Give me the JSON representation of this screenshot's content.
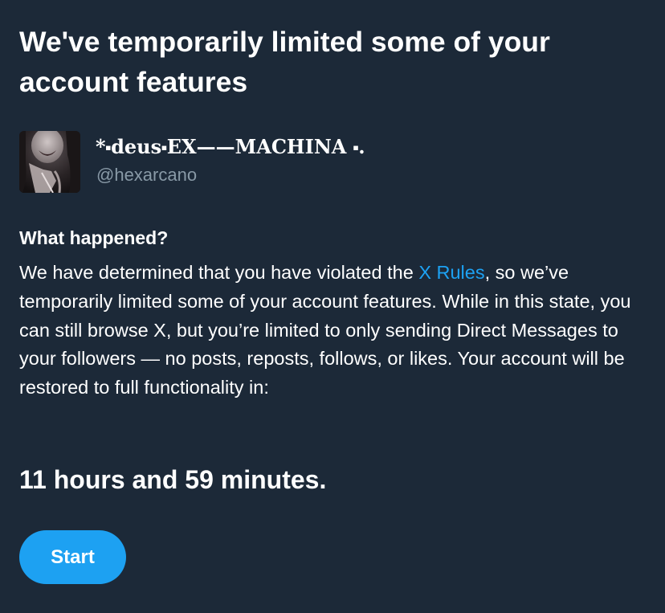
{
  "header": {
    "title": "We've temporarily limited some of your account features"
  },
  "account": {
    "display_name": "*⬝deus⬝EX——MACHINA ⬝.",
    "handle": "@hexarcano",
    "avatar_icon": "profile-photo"
  },
  "details": {
    "heading": "What happened?",
    "text_before_link": "We have determined that you have violated the ",
    "link_text": "X Rules",
    "text_after_link": ", so we’ve temporarily limited some of your account features. While in this state, you can still browse X, but you’re limited to only sending Direct Messages to your followers — no posts, reposts, follows, or likes. Your account will be restored to full functionality in:"
  },
  "countdown": {
    "value": "11 hours and 59 minutes."
  },
  "actions": {
    "start_label": "Start"
  },
  "colors": {
    "background": "#1c2938",
    "accent": "#1da1f2",
    "secondary_text": "#8899a6"
  }
}
